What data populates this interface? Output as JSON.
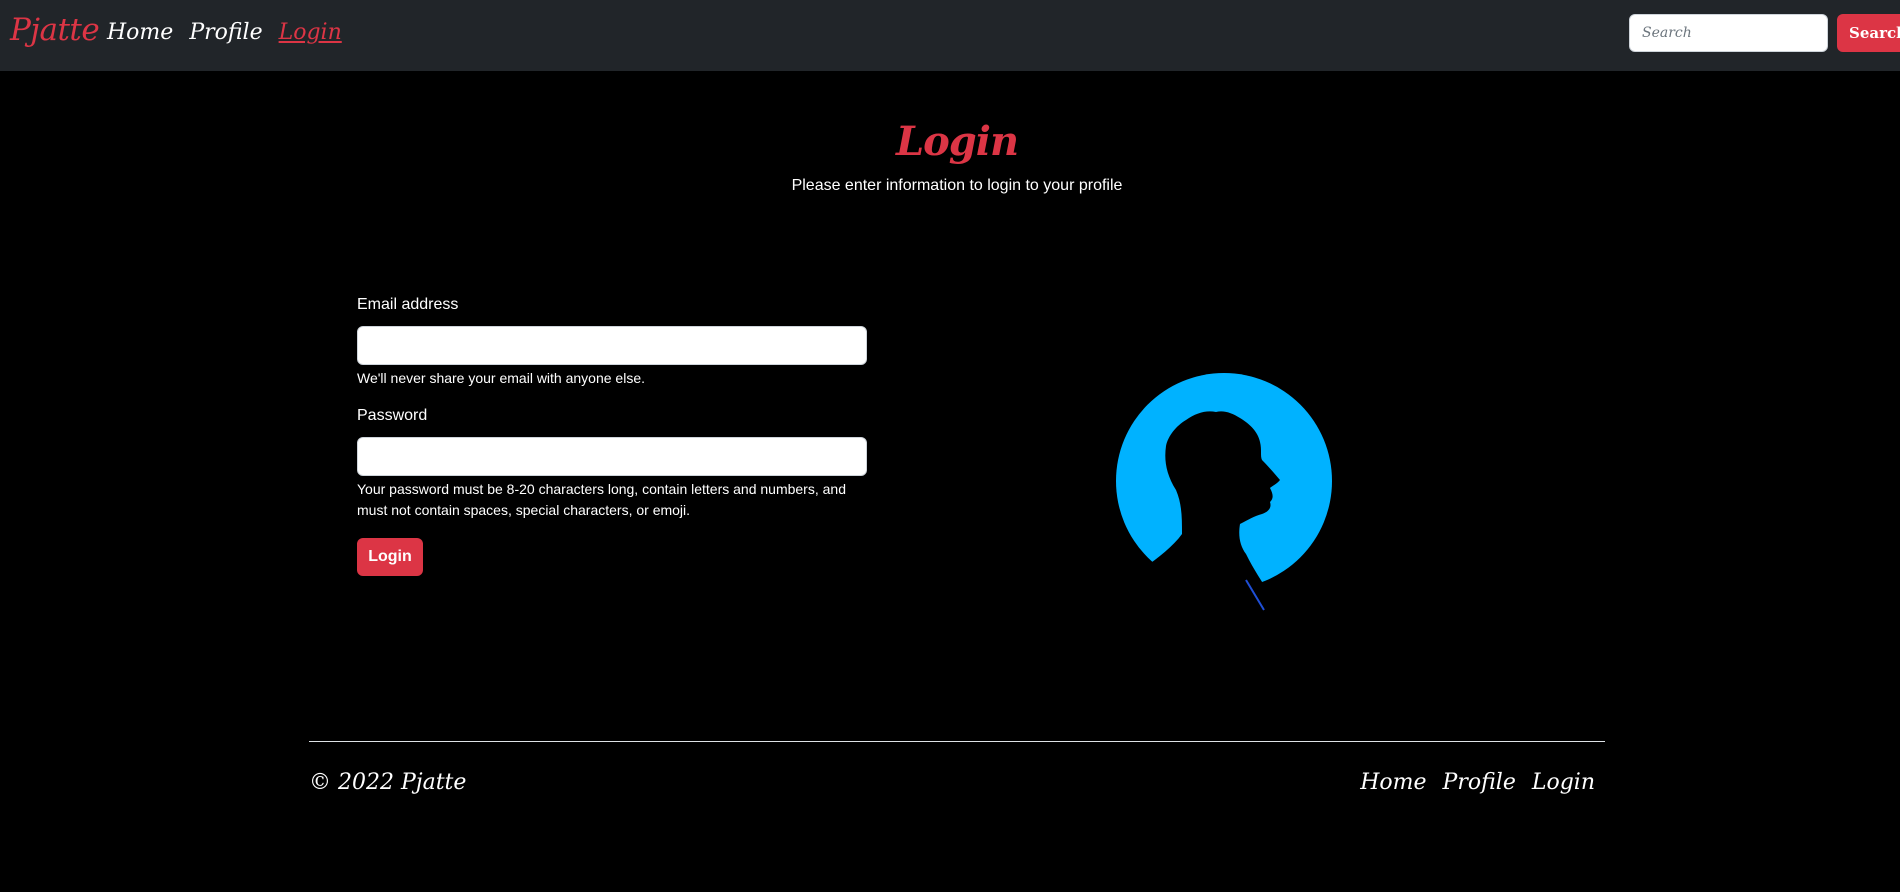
{
  "navbar": {
    "brand": "Pjatte",
    "links": [
      {
        "label": "Home"
      },
      {
        "label": "Profile"
      },
      {
        "label": "Login"
      }
    ],
    "search": {
      "placeholder": "Search",
      "value": "",
      "button_label": "Search"
    }
  },
  "main": {
    "title": "Login",
    "subtitle": "Please enter information to login to your profile",
    "form": {
      "email_label": "Email address",
      "email_value": "",
      "email_help": "We'll never share your email with anyone else.",
      "password_label": "Password",
      "password_value": "",
      "password_help": "Your password must be 8-20 characters long, contain letters and numbers, and must not contain spaces, special characters, or emoji.",
      "submit_label": "Login"
    },
    "illustration": {
      "icon": "profile-silhouette-icon",
      "circle_color": "#00b2ff"
    }
  },
  "footer": {
    "copyright": "© 2022 Pjatte",
    "links": [
      {
        "label": "Home"
      },
      {
        "label": "Profile"
      },
      {
        "label": "Login"
      }
    ]
  },
  "colors": {
    "accent": "#dc3545",
    "navbar_bg": "#212529",
    "page_bg": "#000000"
  }
}
